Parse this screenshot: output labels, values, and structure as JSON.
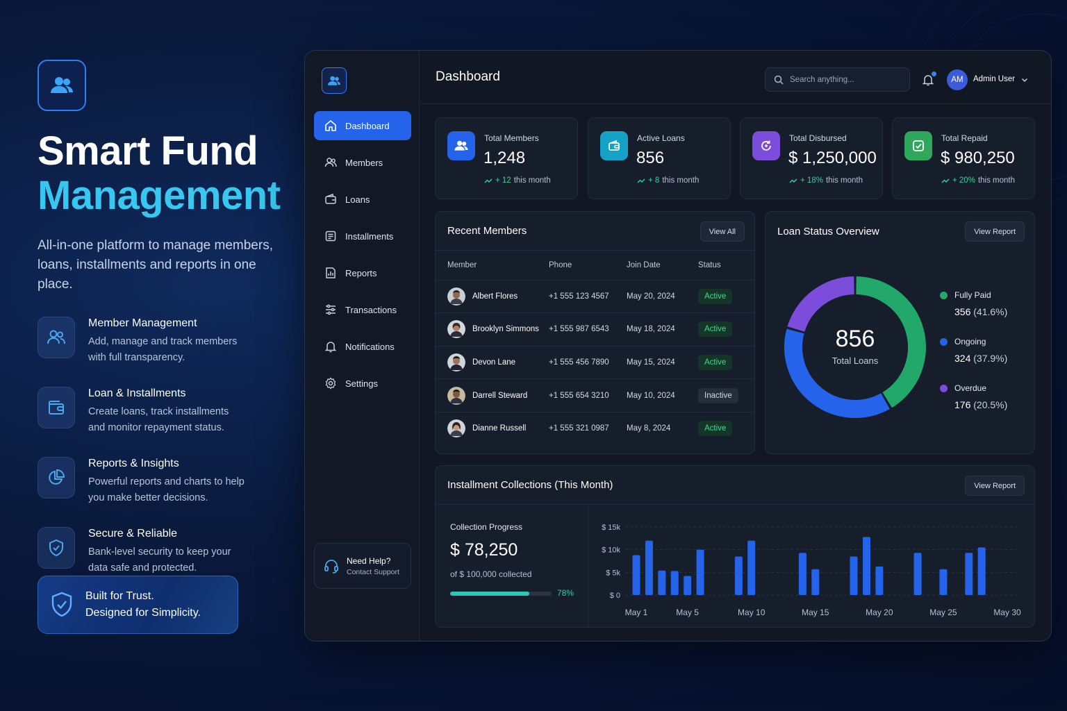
{
  "hero": {
    "title_line1": "Smart Fund",
    "title_line2": "Management",
    "description": "All-in-one platform to manage members, loans, installments and reports in one place.",
    "features": [
      {
        "title": "Member Management",
        "desc": "Add, manage and track members with full transparency.",
        "icon": "users-icon"
      },
      {
        "title": "Loan & Installments",
        "desc": "Create loans, track installments and monitor repayment status.",
        "icon": "wallet-icon"
      },
      {
        "title": "Reports & Insights",
        "desc": "Powerful reports and charts to help you make better decisions.",
        "icon": "pie-chart-icon"
      },
      {
        "title": "Secure & Reliable",
        "desc": "Bank-level security to keep your data safe and protected.",
        "icon": "shield-icon"
      }
    ],
    "trust_line1": "Built for Trust.",
    "trust_line2": "Designed for Simplicity."
  },
  "sidebar": {
    "items": [
      {
        "label": "Dashboard",
        "icon": "home-icon",
        "active": true
      },
      {
        "label": "Members",
        "icon": "users-icon"
      },
      {
        "label": "Loans",
        "icon": "wallet-icon"
      },
      {
        "label": "Installments",
        "icon": "list-icon"
      },
      {
        "label": "Reports",
        "icon": "report-icon"
      },
      {
        "label": "Transactions",
        "icon": "sliders-icon"
      },
      {
        "label": "Notifications",
        "icon": "bell-icon"
      },
      {
        "label": "Settings",
        "icon": "gear-icon"
      }
    ],
    "help_title": "Need Help?",
    "help_sub": "Contact Support"
  },
  "header": {
    "title": "Dashboard",
    "search_placeholder": "Search anything...",
    "user_initials": "AM",
    "user_name": "Admin User"
  },
  "stats": [
    {
      "label": "Total Members",
      "value": "1,248",
      "change": "+ 12",
      "period": "this month",
      "color": "#2563eb"
    },
    {
      "label": "Active Loans",
      "value": "856",
      "change": "+ 8",
      "period": "this month",
      "color": "#14a3c7"
    },
    {
      "label": "Total Disbursed",
      "value": "$ 1,250,000",
      "change": "+ 18%",
      "period": "this month",
      "color": "#7c4ddb"
    },
    {
      "label": "Total Repaid",
      "value": "$ 980,250",
      "change": "+ 20%",
      "period": "this month",
      "color": "#2fa85b"
    }
  ],
  "recent_members": {
    "title": "Recent Members",
    "button": "View All",
    "columns": [
      "Member",
      "Phone",
      "Join Date",
      "Status"
    ],
    "rows": [
      {
        "name": "Albert Flores",
        "phone": "+1 555 123 4567",
        "date": "May 20, 2024",
        "status": "Active"
      },
      {
        "name": "Brooklyn Simmons",
        "phone": "+1 555 987 6543",
        "date": "May 18, 2024",
        "status": "Active"
      },
      {
        "name": "Devon Lane",
        "phone": "+1 555 456 7890",
        "date": "May 15, 2024",
        "status": "Active"
      },
      {
        "name": "Darrell Steward",
        "phone": "+1 555 654 3210",
        "date": "May 10, 2024",
        "status": "Inactive"
      },
      {
        "name": "Dianne Russell",
        "phone": "+1 555 321 0987",
        "date": "May 8, 2024",
        "status": "Active"
      }
    ]
  },
  "loan_status": {
    "title": "Loan Status Overview",
    "button": "View Report",
    "center_value": "856",
    "center_label": "Total Loans",
    "legend": [
      {
        "label": "Fully Paid",
        "count": "356",
        "pct": "(41.6%)",
        "color": "#22a86a"
      },
      {
        "label": "Ongoing",
        "count": "324",
        "pct": "(37.9%)",
        "color": "#2563eb"
      },
      {
        "label": "Overdue",
        "count": "176",
        "pct": "(20.5%)",
        "color": "#7c4ddb"
      }
    ]
  },
  "collections": {
    "title": "Installment Collections (This Month)",
    "button": "View Report",
    "progress_label": "Collection Progress",
    "amount": "$ 78,250",
    "sub": "of $ 100,000 collected",
    "percent_text": "78%",
    "percent": 0.78
  },
  "chart_data": {
    "type": "bar",
    "y_ticks": [
      "$ 15k",
      "$ 10k",
      "$ 5k",
      "$ 0"
    ],
    "ylim": [
      0,
      15
    ],
    "x_tick_labels": [
      "May 1",
      "May 5",
      "May 10",
      "May 15",
      "May 20",
      "May 25",
      "May 30"
    ],
    "x_tick_days": [
      1,
      5,
      10,
      15,
      20,
      25,
      30
    ],
    "days": [
      1,
      2,
      3,
      4,
      5,
      6,
      7,
      8,
      9,
      10,
      11,
      12,
      13,
      14,
      15,
      16,
      17,
      18,
      19,
      20,
      21,
      22,
      23,
      24,
      25,
      26,
      27,
      28,
      29,
      30
    ],
    "values": [
      8.8,
      12,
      5.4,
      5.3,
      4.2,
      10,
      0,
      0,
      8.5,
      12,
      0,
      0,
      0,
      9.3,
      5.7,
      0,
      0,
      8.5,
      12.8,
      6.3,
      0,
      0,
      9.3,
      0,
      5.7,
      0,
      9.3,
      10.5,
      0,
      0
    ]
  }
}
